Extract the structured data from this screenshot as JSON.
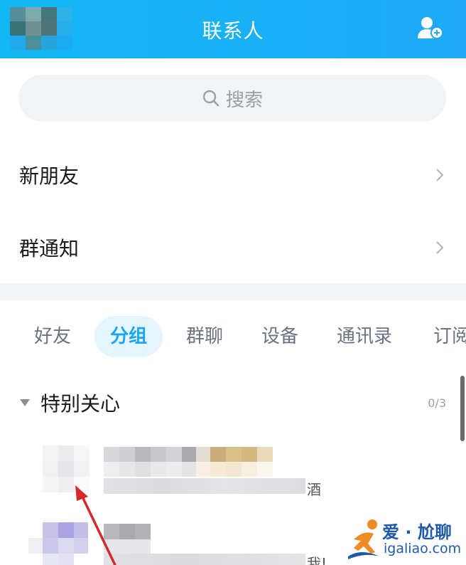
{
  "header": {
    "title": "联系人",
    "background": "#12b7f5",
    "add_icon": "add-contact-icon"
  },
  "search": {
    "label": "搜索",
    "icon": "search-icon"
  },
  "rows": [
    {
      "label": "新朋友"
    },
    {
      "label": "群通知"
    }
  ],
  "tabs": [
    {
      "label": "好友",
      "active": false
    },
    {
      "label": "分组",
      "active": true
    },
    {
      "label": "群聊",
      "active": false
    },
    {
      "label": "设备",
      "active": false
    },
    {
      "label": "通讯录",
      "active": false
    },
    {
      "label": "订阅",
      "active": false
    }
  ],
  "group": {
    "title": "特别关心",
    "count": "0/3"
  },
  "contacts": [
    {
      "status_suffix": "酒"
    },
    {
      "status_suffix": "我!"
    }
  ],
  "watermark": {
    "line1": "爱 · 尬聊",
    "line2": "igaliao.com"
  },
  "colors": {
    "accent": "#1aa6f0",
    "annotation_arrow": "#d42a2a"
  }
}
